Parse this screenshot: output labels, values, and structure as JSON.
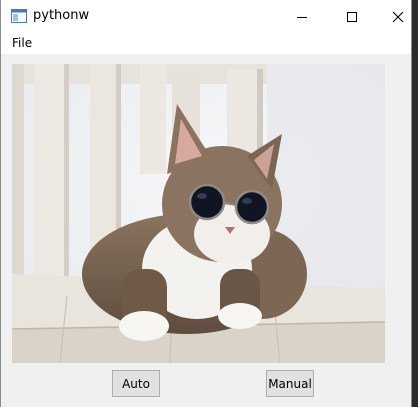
{
  "window": {
    "title": "pythonw",
    "icon": "python-window-icon",
    "controls": [
      "minimize-icon",
      "maximize-icon",
      "close-icon"
    ]
  },
  "menu": {
    "items": [
      {
        "label": "File"
      }
    ]
  },
  "image": {
    "subject": "cat wearing round sunglasses on a white wooden chair"
  },
  "buttons": {
    "auto_label": "Auto",
    "manual_label": "Manual"
  }
}
